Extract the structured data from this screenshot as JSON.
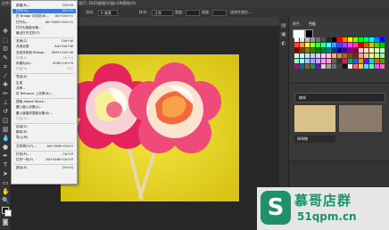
{
  "menubar": {
    "items": [
      "文件(F)",
      "编辑(E)",
      "图像(I)",
      "图层(L)",
      "文字(Y)",
      "选择(S)",
      "滤镜(T)",
      "3D(D)",
      "视图(V)",
      "窗口(W)",
      "帮助(H)"
    ]
  },
  "options": {
    "feather_label": "羽化:",
    "feather_value": "0 像素",
    "style_label": "样式:",
    "style_value": "正常",
    "width_label": "宽度:",
    "height_label": "高度:",
    "refine_label": "选择并遮住..."
  },
  "file_menu": {
    "items": [
      {
        "label": "新建(N)...",
        "shortcut": "Ctrl+N",
        "disabled": false,
        "highlight": false
      },
      {
        "label": "打开(O)...",
        "shortcut": "Ctrl+O",
        "disabled": false,
        "highlight": true
      },
      {
        "label": "在 Bridge 中浏览(B)...",
        "shortcut": "Alt+Ctrl+O",
        "disabled": false,
        "highlight": false
      },
      {
        "label": "打开为...",
        "shortcut": "Alt+Shift+Ctrl+O",
        "disabled": false,
        "highlight": false
      },
      {
        "label": "打开为智能对象...",
        "shortcut": "",
        "disabled": false,
        "highlight": false
      },
      {
        "label": "最近打开文件(T)",
        "shortcut": "",
        "disabled": false,
        "highlight": false,
        "sep_after": true
      },
      {
        "label": "关闭(C)",
        "shortcut": "Ctrl+W",
        "disabled": false,
        "highlight": false
      },
      {
        "label": "关闭全部",
        "shortcut": "Alt+Ctrl+W",
        "disabled": false,
        "highlight": false
      },
      {
        "label": "关闭并转到 Bridge...",
        "shortcut": "Shift+Ctrl+W",
        "disabled": false,
        "highlight": false
      },
      {
        "label": "存储(S)",
        "shortcut": "Ctrl+S",
        "disabled": true,
        "highlight": false
      },
      {
        "label": "存储为(A)...",
        "shortcut": "Shift+Ctrl+S",
        "disabled": false,
        "highlight": false
      },
      {
        "label": "恢复(V)",
        "shortcut": "F12",
        "disabled": true,
        "highlight": false,
        "sep_after": true
      },
      {
        "label": "导出(E)",
        "shortcut": "",
        "disabled": false,
        "highlight": false
      },
      {
        "label": "生成",
        "shortcut": "",
        "disabled": false,
        "highlight": false
      },
      {
        "label": "共享...",
        "shortcut": "",
        "disabled": false,
        "highlight": false
      },
      {
        "label": "在 Behance 上共享(D)...",
        "shortcut": "",
        "disabled": false,
        "highlight": false,
        "sep_after": true
      },
      {
        "label": "搜索 Adobe Stock...",
        "shortcut": "",
        "disabled": false,
        "highlight": false
      },
      {
        "label": "置入嵌入对象(L)...",
        "shortcut": "",
        "disabled": false,
        "highlight": false
      },
      {
        "label": "置入链接的智能对象(K)...",
        "shortcut": "",
        "disabled": false,
        "highlight": false
      },
      {
        "label": "打包(G)...",
        "shortcut": "",
        "disabled": true,
        "highlight": false,
        "sep_after": true
      },
      {
        "label": "自动(U)",
        "shortcut": "",
        "disabled": false,
        "highlight": false
      },
      {
        "label": "脚本(R)",
        "shortcut": "",
        "disabled": false,
        "highlight": false
      },
      {
        "label": "导入(M)",
        "shortcut": "",
        "disabled": false,
        "highlight": false,
        "sep_after": true
      },
      {
        "label": "文件简介(F)...",
        "shortcut": "Alt+Shift+Ctrl+I",
        "disabled": false,
        "highlight": false,
        "sep_after": true
      },
      {
        "label": "打印(P)...",
        "shortcut": "Ctrl+P",
        "disabled": false,
        "highlight": false
      },
      {
        "label": "打印一份(Y)",
        "shortcut": "Alt+Shift+Ctrl+P",
        "disabled": false,
        "highlight": false,
        "sep_after": true
      },
      {
        "label": "退出(X)",
        "shortcut": "Ctrl+Q",
        "disabled": false,
        "highlight": false
      }
    ]
  },
  "swatch_panel": {
    "tabs": [
      "颜色",
      "色板"
    ]
  },
  "library_panel": {
    "title": "糖果",
    "item_label": "棒棒糖"
  },
  "watermark": {
    "badge": "S",
    "title": "慕哥店群",
    "url": "51qpm.cn"
  },
  "colors": {
    "menu_highlight": "#3f7ad6",
    "watermark_green": "#1f8f6c",
    "photo_yellow": "#e6d21c"
  },
  "swatch_colors": [
    "#ffffff",
    "#e6e6e6",
    "#bfbfbf",
    "#999999",
    "#737373",
    "#4d4d4d",
    "#262626",
    "#000000",
    "#ff0000",
    "#ff8000",
    "#ffff00",
    "#80ff00",
    "#00ff00",
    "#00ff80",
    "#00ffff",
    "#0080ff",
    "#0000ff",
    "#ff4040",
    "#ff9a40",
    "#ffff40",
    "#9aff40",
    "#40ff40",
    "#40ff9a",
    "#40ffff",
    "#409aff",
    "#4040ff",
    "#9a40ff",
    "#ff40ff",
    "#ff409a",
    "#c80000",
    "#c86400",
    "#c8c800",
    "#64c800",
    "#00c800",
    "#800000",
    "#804000",
    "#808000",
    "#408000",
    "#008000",
    "#008040",
    "#008080",
    "#004080",
    "#000080",
    "#400080",
    "#800080",
    "#800040",
    "#ffc8c8",
    "#ffe0c8",
    "#ffffc8",
    "#e0ffc8",
    "#c8ffc8",
    "#c8ffe0",
    "#c8ffff",
    "#c8e0ff",
    "#c8c8ff",
    "#e0c8ff",
    "#ffc8ff",
    "#ffc8e0",
    "#e8b38a",
    "#c89060",
    "#a06b3c",
    "#7a4a22",
    "#5a3212",
    "#f4a0a0",
    "#f4c8a0",
    "#f4f4a0",
    "#c8f4a0",
    "#a0f4a0",
    "#a0f4c8",
    "#a0f4f4",
    "#a0c8f4",
    "#a0a0f4",
    "#c8a0f4",
    "#f4a0f4",
    "#f4a0c8",
    "#606060",
    "#303030",
    "#d02060",
    "#20a060",
    "#2060d0",
    "#d0a020",
    "#6020d0",
    "#20d0d0",
    "#d06020",
    "#609020",
    "#902060",
    "#206090",
    "#906020",
    "#209060",
    "#602090",
    "#d0d0d0",
    "#a0a0a0",
    "#707070",
    "#404040",
    "#101010",
    "#f0f0f0",
    "#ff6666",
    "#ffcc66",
    "#66ccff",
    "#66ff99",
    "#cc66ff",
    "#ff66cc"
  ]
}
